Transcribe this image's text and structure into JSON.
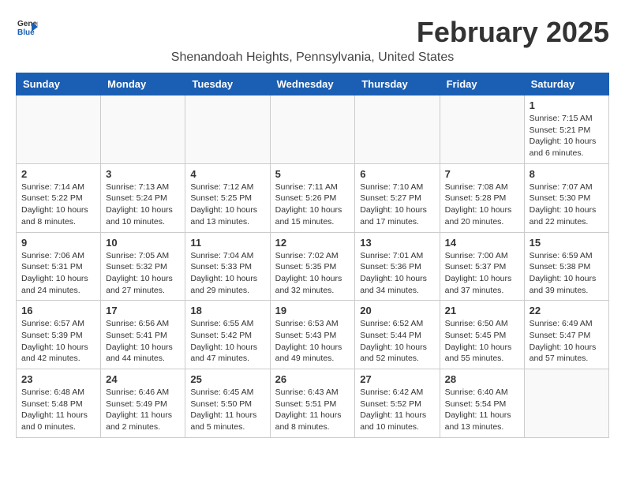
{
  "app": {
    "logo_line1": "General",
    "logo_line2": "Blue"
  },
  "header": {
    "month_year": "February 2025",
    "location": "Shenandoah Heights, Pennsylvania, United States"
  },
  "weekdays": [
    "Sunday",
    "Monday",
    "Tuesday",
    "Wednesday",
    "Thursday",
    "Friday",
    "Saturday"
  ],
  "weeks": [
    [
      {
        "day": "",
        "info": ""
      },
      {
        "day": "",
        "info": ""
      },
      {
        "day": "",
        "info": ""
      },
      {
        "day": "",
        "info": ""
      },
      {
        "day": "",
        "info": ""
      },
      {
        "day": "",
        "info": ""
      },
      {
        "day": "1",
        "info": "Sunrise: 7:15 AM\nSunset: 5:21 PM\nDaylight: 10 hours and 6 minutes."
      }
    ],
    [
      {
        "day": "2",
        "info": "Sunrise: 7:14 AM\nSunset: 5:22 PM\nDaylight: 10 hours and 8 minutes."
      },
      {
        "day": "3",
        "info": "Sunrise: 7:13 AM\nSunset: 5:24 PM\nDaylight: 10 hours and 10 minutes."
      },
      {
        "day": "4",
        "info": "Sunrise: 7:12 AM\nSunset: 5:25 PM\nDaylight: 10 hours and 13 minutes."
      },
      {
        "day": "5",
        "info": "Sunrise: 7:11 AM\nSunset: 5:26 PM\nDaylight: 10 hours and 15 minutes."
      },
      {
        "day": "6",
        "info": "Sunrise: 7:10 AM\nSunset: 5:27 PM\nDaylight: 10 hours and 17 minutes."
      },
      {
        "day": "7",
        "info": "Sunrise: 7:08 AM\nSunset: 5:28 PM\nDaylight: 10 hours and 20 minutes."
      },
      {
        "day": "8",
        "info": "Sunrise: 7:07 AM\nSunset: 5:30 PM\nDaylight: 10 hours and 22 minutes."
      }
    ],
    [
      {
        "day": "9",
        "info": "Sunrise: 7:06 AM\nSunset: 5:31 PM\nDaylight: 10 hours and 24 minutes."
      },
      {
        "day": "10",
        "info": "Sunrise: 7:05 AM\nSunset: 5:32 PM\nDaylight: 10 hours and 27 minutes."
      },
      {
        "day": "11",
        "info": "Sunrise: 7:04 AM\nSunset: 5:33 PM\nDaylight: 10 hours and 29 minutes."
      },
      {
        "day": "12",
        "info": "Sunrise: 7:02 AM\nSunset: 5:35 PM\nDaylight: 10 hours and 32 minutes."
      },
      {
        "day": "13",
        "info": "Sunrise: 7:01 AM\nSunset: 5:36 PM\nDaylight: 10 hours and 34 minutes."
      },
      {
        "day": "14",
        "info": "Sunrise: 7:00 AM\nSunset: 5:37 PM\nDaylight: 10 hours and 37 minutes."
      },
      {
        "day": "15",
        "info": "Sunrise: 6:59 AM\nSunset: 5:38 PM\nDaylight: 10 hours and 39 minutes."
      }
    ],
    [
      {
        "day": "16",
        "info": "Sunrise: 6:57 AM\nSunset: 5:39 PM\nDaylight: 10 hours and 42 minutes."
      },
      {
        "day": "17",
        "info": "Sunrise: 6:56 AM\nSunset: 5:41 PM\nDaylight: 10 hours and 44 minutes."
      },
      {
        "day": "18",
        "info": "Sunrise: 6:55 AM\nSunset: 5:42 PM\nDaylight: 10 hours and 47 minutes."
      },
      {
        "day": "19",
        "info": "Sunrise: 6:53 AM\nSunset: 5:43 PM\nDaylight: 10 hours and 49 minutes."
      },
      {
        "day": "20",
        "info": "Sunrise: 6:52 AM\nSunset: 5:44 PM\nDaylight: 10 hours and 52 minutes."
      },
      {
        "day": "21",
        "info": "Sunrise: 6:50 AM\nSunset: 5:45 PM\nDaylight: 10 hours and 55 minutes."
      },
      {
        "day": "22",
        "info": "Sunrise: 6:49 AM\nSunset: 5:47 PM\nDaylight: 10 hours and 57 minutes."
      }
    ],
    [
      {
        "day": "23",
        "info": "Sunrise: 6:48 AM\nSunset: 5:48 PM\nDaylight: 11 hours and 0 minutes."
      },
      {
        "day": "24",
        "info": "Sunrise: 6:46 AM\nSunset: 5:49 PM\nDaylight: 11 hours and 2 minutes."
      },
      {
        "day": "25",
        "info": "Sunrise: 6:45 AM\nSunset: 5:50 PM\nDaylight: 11 hours and 5 minutes."
      },
      {
        "day": "26",
        "info": "Sunrise: 6:43 AM\nSunset: 5:51 PM\nDaylight: 11 hours and 8 minutes."
      },
      {
        "day": "27",
        "info": "Sunrise: 6:42 AM\nSunset: 5:52 PM\nDaylight: 11 hours and 10 minutes."
      },
      {
        "day": "28",
        "info": "Sunrise: 6:40 AM\nSunset: 5:54 PM\nDaylight: 11 hours and 13 minutes."
      },
      {
        "day": "",
        "info": ""
      }
    ]
  ]
}
